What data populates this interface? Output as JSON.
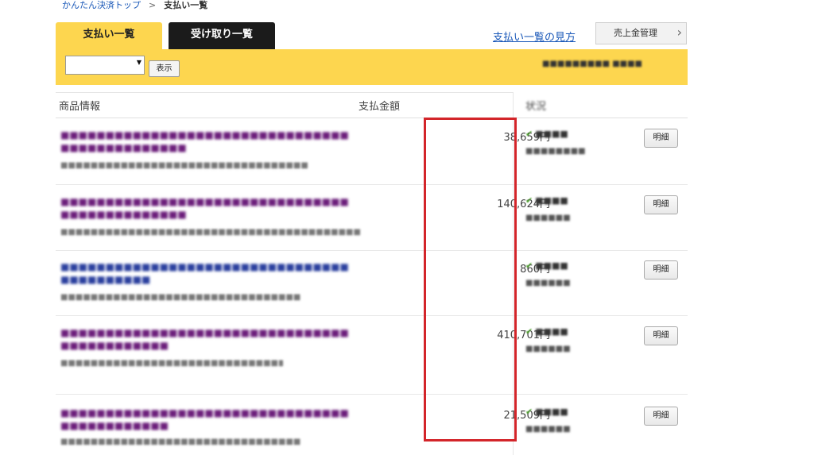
{
  "breadcrumb": {
    "home": "かんたん決済トップ",
    "separator": ">",
    "current": "支払い一覧"
  },
  "tabs": [
    {
      "label": "支払い一覧",
      "active": true
    },
    {
      "label": "受け取り一覧",
      "active": false
    }
  ],
  "help_link": "支払い一覧の見方",
  "sales_button": "売上金管理",
  "filter": {
    "select_value": "",
    "show_button": "表示",
    "info_text": "■■■■■■■■■ ■■■■"
  },
  "columns": {
    "item": "商品情報",
    "amount": "支払金額",
    "status": "状況"
  },
  "rows": [
    {
      "title": "■■■■■■■■■■■■■■■■■■■■■■■■■■■■■■■■■■■■■■■■■■■■■■",
      "title_color": "#6b1d7a",
      "sub": "■■■■■■■■■■■■■■■■■■■■■■■■■■■■■■■■■",
      "amount": "38,659円",
      "status": "■■■■",
      "date": "■■■■■■■■",
      "detail": "明細"
    },
    {
      "title": "■■■■■■■■■■■■■■■■■■■■■■■■■■■■■■■■■■■■■■■■■■■■■■",
      "title_color": "#6b1d7a",
      "sub": "■■■■■■■■■■■■■■■■■■■■■■■■■■■■■■■■■■■■■■■■",
      "amount": "140,624円",
      "status": "■■■■",
      "date": "■■■■■■",
      "detail": "明細"
    },
    {
      "title": "■■■■■■■■■■■■■■■■■■■■■■■■■■■■■■■■■■■■■■■■■■",
      "title_color": "#2a3f9e",
      "sub": "■■■■■■■■■■■■■■■■■■■■■■■■■■■■■■■■",
      "amount": "860円",
      "status": "■■■■",
      "date": "■■■■■■",
      "detail": "明細"
    },
    {
      "title": "■■■■■■■■■■■■■■■■■■■■■■■■■■■■■■■■■■■■■■■■■■■■",
      "title_color": "#6b1d7a",
      "sub": "■■■■■■■■■■■■■■■■■■■■■■■■■■■■■■■■■■■■■■■■■",
      "amount": "410,701円",
      "status": "■■■■",
      "date": "■■■■■■",
      "detail": "明細"
    },
    {
      "title": "■■■■■■■■■■■■■■■■■■■■■■■■■■■■■■■■■■■■■■■■■■■■",
      "title_color": "#6b1d7a",
      "sub": "■■■■■■■■■■■■■■■■■■■■■■■■■■■■■■■■",
      "amount": "21,509円",
      "status": "■■■■",
      "date": "■■■■■■",
      "detail": "明細"
    }
  ],
  "highlight_color": "#d3252a"
}
